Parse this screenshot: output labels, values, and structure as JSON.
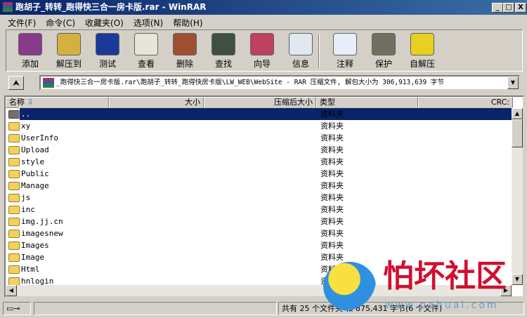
{
  "window": {
    "title": "跑胡子_转转_跑得快三合一房卡版.rar - WinRAR",
    "min": "_",
    "max": "□",
    "close": "X"
  },
  "menu": [
    "文件(F)",
    "命令(C)",
    "收藏夹(O)",
    "选项(N)",
    "帮助(H)"
  ],
  "toolbar": [
    {
      "label": "添加",
      "icon": "add-archive-icon",
      "color": "#8a3a8a"
    },
    {
      "label": "解压到",
      "icon": "extract-to-icon",
      "color": "#d4b040"
    },
    {
      "label": "测试",
      "icon": "test-icon",
      "color": "#1a3a9a"
    },
    {
      "label": "查看",
      "icon": "view-icon",
      "color": "#e8e4d8"
    },
    {
      "label": "删除",
      "icon": "delete-icon",
      "color": "#a05030"
    },
    {
      "label": "查找",
      "icon": "find-icon",
      "color": "#405040"
    },
    {
      "label": "向导",
      "icon": "wizard-icon",
      "color": "#c04060"
    },
    {
      "label": "信息",
      "icon": "info-icon",
      "color": "#e0e8f0"
    },
    {
      "label": "注释",
      "icon": "comment-icon",
      "color": "#e8eef8"
    },
    {
      "label": "保护",
      "icon": "protect-icon",
      "color": "#707060"
    },
    {
      "label": "自解压",
      "icon": "sfx-icon",
      "color": "#e8d020"
    }
  ],
  "address": {
    "path": "_跑得快三合一房卡版.rar\\跑胡子_转转_跑得快房卡版\\LW_WEB\\WebSite - RAR 压缩文件, 解包大小为 306,913,639 字节"
  },
  "columns": {
    "name": "名称",
    "size": "大小",
    "packed": "压缩后大小",
    "type": "类型",
    "crc": "CRC:"
  },
  "files": [
    {
      "name": "..",
      "type": "资料夹"
    },
    {
      "name": "xy",
      "type": "资料夹"
    },
    {
      "name": "UserInfo",
      "type": "资料夹"
    },
    {
      "name": "Upload",
      "type": "资料夹"
    },
    {
      "name": "style",
      "type": "资料夹"
    },
    {
      "name": "Public",
      "type": "资料夹"
    },
    {
      "name": "Manage",
      "type": "资料夹"
    },
    {
      "name": "js",
      "type": "资料夹"
    },
    {
      "name": "inc",
      "type": "资料夹"
    },
    {
      "name": "img.jj.cn",
      "type": "资料夹"
    },
    {
      "name": "imagesnew",
      "type": "资料夹"
    },
    {
      "name": "Images",
      "type": "资料夹"
    },
    {
      "name": "Image",
      "type": "资料夹"
    },
    {
      "name": "Html",
      "type": "资料夹"
    },
    {
      "name": "hnlogin",
      "type": "资料夹"
    }
  ],
  "status": {
    "text": "共有 25 个文件夹 和 875,431 字节(6 个文件)"
  },
  "watermark": {
    "brand": "怕坏社区",
    "url": "www.pahuai.com"
  }
}
